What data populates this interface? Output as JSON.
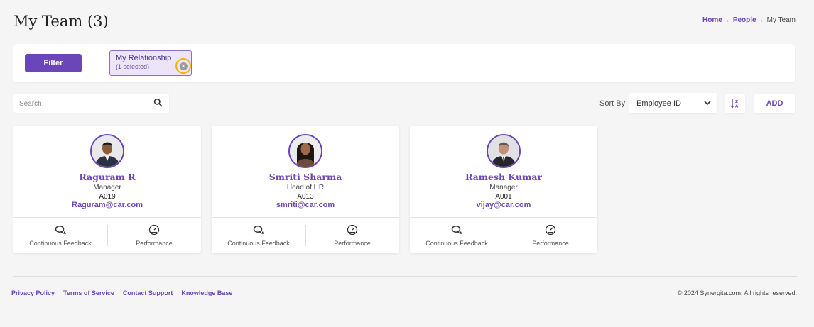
{
  "header": {
    "title": "My Team (3)",
    "breadcrumb": {
      "home": "Home",
      "people": "People",
      "current": "My Team"
    }
  },
  "filter": {
    "button_label": "Filter",
    "chip": {
      "title": "My Relationship",
      "subtitle": "(1 selected)"
    }
  },
  "search": {
    "placeholder": "Search"
  },
  "sort": {
    "label": "Sort By",
    "selected": "Employee ID",
    "direction_icon": "sort-az-icon"
  },
  "toolbar": {
    "add_label": "ADD"
  },
  "cards": [
    {
      "name": "Raguram R",
      "role": "Manager",
      "id": "A019",
      "email": "Raguram@car.com",
      "feedback_label": "Continuous Feedback",
      "performance_label": "Performance"
    },
    {
      "name": "Smriti Sharma",
      "role": "Head of HR",
      "id": "A013",
      "email": "smriti@car.com",
      "feedback_label": "Continuous Feedback",
      "performance_label": "Performance"
    },
    {
      "name": "Ramesh Kumar",
      "role": "Manager",
      "id": "A001",
      "email": "vijay@car.com",
      "feedback_label": "Continuous Feedback",
      "performance_label": "Performance"
    }
  ],
  "footer": {
    "links": [
      "Privacy Policy",
      "Terms of Service",
      "Contact Support",
      "Knowledge Base"
    ],
    "copyright": "© 2024 Synergita.com. All rights reserved."
  },
  "colors": {
    "accent": "#6b46b8",
    "highlight": "#f0b400",
    "background": "#f5f5f5"
  }
}
